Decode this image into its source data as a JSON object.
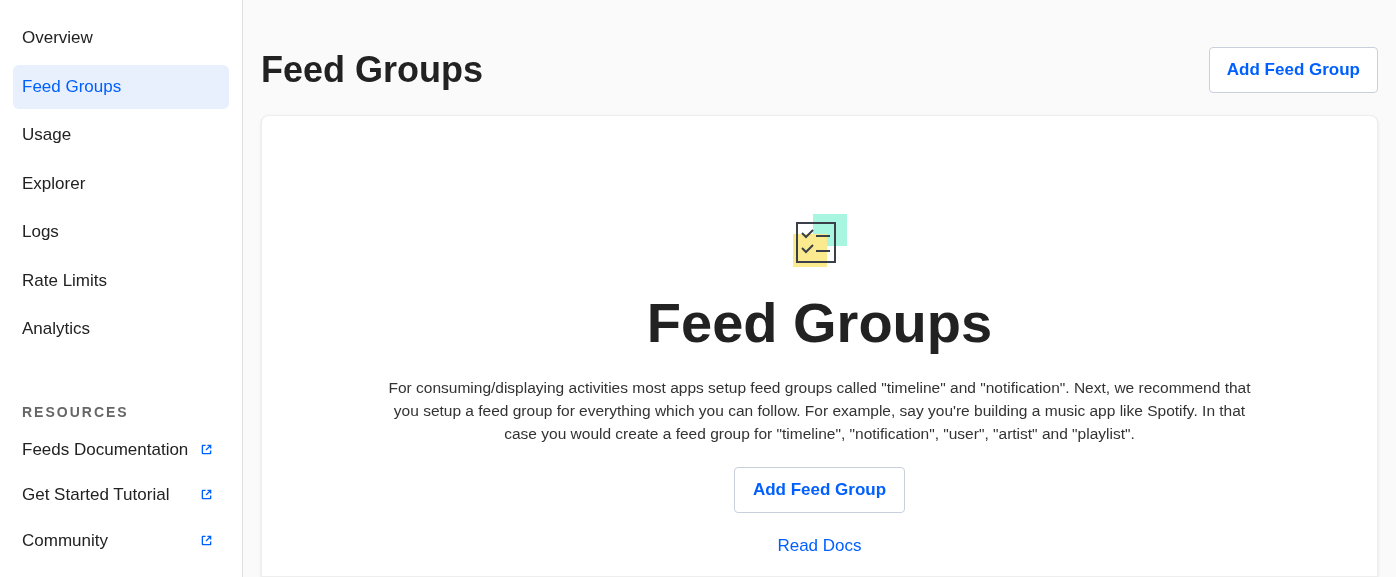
{
  "sidebar": {
    "items": [
      {
        "label": "Overview",
        "selected": false
      },
      {
        "label": "Feed Groups",
        "selected": true
      },
      {
        "label": "Usage",
        "selected": false
      },
      {
        "label": "Explorer",
        "selected": false
      },
      {
        "label": "Logs",
        "selected": false
      },
      {
        "label": "Rate Limits",
        "selected": false
      },
      {
        "label": "Analytics",
        "selected": false
      }
    ],
    "resources_heading": "RESOURCES",
    "resources": [
      {
        "label": "Feeds Documentation"
      },
      {
        "label": "Get Started Tutorial"
      },
      {
        "label": "Community"
      }
    ]
  },
  "header": {
    "title": "Feed Groups",
    "button": "Add Feed Group"
  },
  "empty_state": {
    "title": "Feed Groups",
    "description": "For consuming/displaying activities most apps setup feed groups called \"timeline\" and \"notification\". Next, we recommend that you setup a feed group for everything which you can follow. For example, say you're building a music app like Spotify. In that case you would create a feed group for \"timeline\", \"notification\", \"user\", \"artist\" and \"playlist\".",
    "button": "Add Feed Group",
    "link": "Read Docs"
  }
}
